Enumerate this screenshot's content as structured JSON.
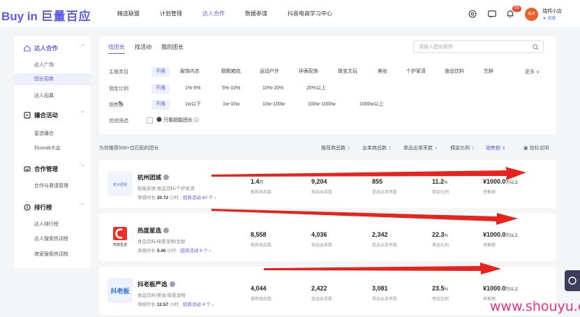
{
  "header": {
    "logo_latin": "Buy in",
    "logo_cn": "巨量百应",
    "nav": [
      "精选联盟",
      "计划管理",
      "达人合作",
      "数据参谋",
      "抖音电商学习中心"
    ],
    "nav_active": 2,
    "notify_count": "99",
    "avatar_text": "杭州",
    "shop_name": "瑞邦小店",
    "shop_tag": "▼ 商家"
  },
  "sidebar": {
    "groups": [
      {
        "label": "达人合作",
        "items": [
          "达人广场",
          "团长招商",
          "达人招募"
        ]
      },
      {
        "label": "撮合活动",
        "items": [
          "星选撮合",
          "抖smak大会"
        ]
      },
      {
        "label": "合作管理",
        "items": [
          "合作与邀请管理"
        ]
      },
      {
        "label": "排行榜",
        "items": [
          "达人排行榜",
          "达人搜索热词榜",
          "商家搜索热词榜"
        ]
      }
    ]
  },
  "filter": {
    "tabs": [
      "找团长",
      "找活动",
      "我的团长"
    ],
    "search_placeholder": "请输入团长昵称",
    "rows": [
      {
        "label": "主推类目",
        "options": [
          "不限",
          "服饰内衣",
          "鞋靴箱包",
          "运动户外",
          "钟表配饰",
          "珠宝文玩",
          "美妆",
          "个护家清",
          "食品饮料",
          "生鲜"
        ]
      },
      {
        "label": "佣金比例",
        "options": [
          "不限",
          "1%-5%",
          "5%-10%",
          "10%-20%",
          "20%以上"
        ]
      },
      {
        "label": "销售额",
        "options": [
          "不限",
          "1w以下",
          "1w-10w",
          "10w-100w",
          "100w-1000w",
          "1000w以上"
        ]
      },
      {
        "label": "其他筛选",
        "options": []
      }
    ],
    "more": "更多 ∨",
    "checkbox_label": "只看超能团长",
    "cursor_glyph": "↖"
  },
  "summary": {
    "text": "为你推荐500+位匹配的团长",
    "sort_headers": [
      "推荐商品数",
      "出单商品数",
      "单品出单率数",
      "佣金比例",
      "销售额"
    ],
    "guide": "指标说明"
  },
  "stat_captions": [
    "推荐商品数",
    "商品出单数",
    "单品出单率数",
    "佣金比例",
    "销售额"
  ],
  "groups": [
    {
      "name": "杭州团城",
      "category": "智能家居/食品饮料/个护家清",
      "meta_label": "审核时长",
      "meta_value": "20.72",
      "meta_unit": "小时",
      "link": "招商活动 60 个 ›",
      "logo_text": "杭州团城",
      "stats": [
        {
          "num": "1.4",
          "unit": "万"
        },
        {
          "num": "9,204",
          "unit": ""
        },
        {
          "num": "855",
          "unit": ""
        },
        {
          "num": "11.2",
          "unit": "%"
        },
        {
          "num": "¥1000.0",
          "unit": "万以上"
        }
      ]
    },
    {
      "name": "热度星选",
      "category": "食品饮料/母婴宠物/生鲜",
      "meta_label": "审核时长",
      "meta_value": "5.40",
      "meta_unit": "小时",
      "link": "招商活动 8 个 ›",
      "logo_text": "热度星选",
      "stats": [
        {
          "num": "8,558",
          "unit": ""
        },
        {
          "num": "4,036",
          "unit": ""
        },
        {
          "num": "2,342",
          "unit": ""
        },
        {
          "num": "22.3",
          "unit": "%"
        },
        {
          "num": "¥1000.0",
          "unit": "万以上"
        }
      ]
    },
    {
      "name": "抖老板严选",
      "category": "食品饮料/美妆/母婴宠物",
      "meta_label": "审核时长",
      "meta_value": "12.57",
      "meta_unit": "小时",
      "link": "招商活动 4 个 ›",
      "logo_text": "抖老板",
      "stats": [
        {
          "num": "4,044",
          "unit": ""
        },
        {
          "num": "2,422",
          "unit": ""
        },
        {
          "num": "3,081",
          "unit": ""
        },
        {
          "num": "23.5",
          "unit": "%"
        },
        {
          "num": "¥1000.0",
          "unit": "万以上"
        }
      ]
    }
  ],
  "watermark": "www.shouyu.ee",
  "colors": {
    "accent": "#5b5be6",
    "annotation_arrow": "#e8221c",
    "watermark": "#e8308e"
  }
}
